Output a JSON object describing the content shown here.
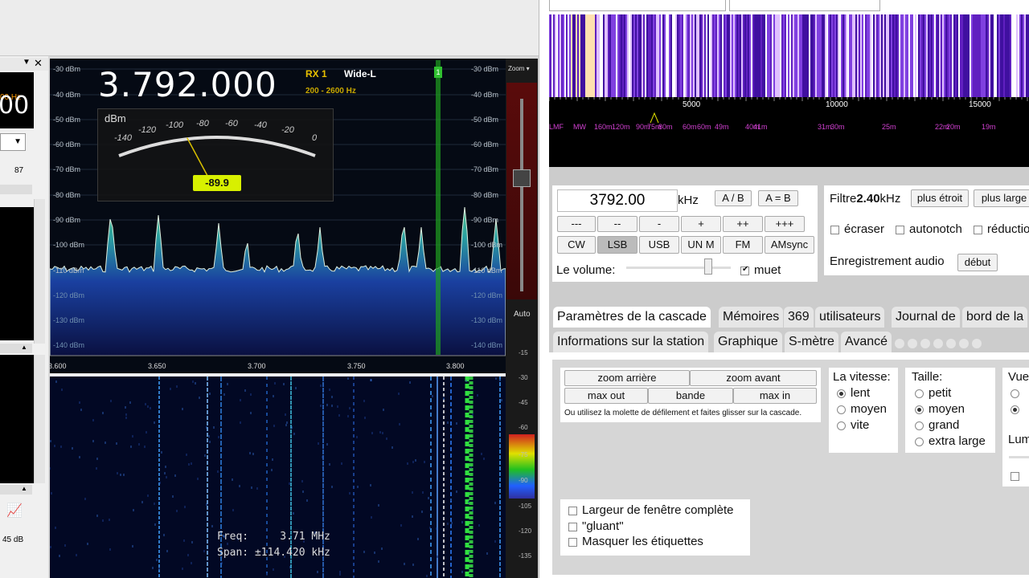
{
  "sdr": {
    "frequency": "3.792.000",
    "rx": "RX 1",
    "filter_mode": "Wide-L",
    "bandwidth": "200 - 2600 Hz",
    "smeter": {
      "unit": "dBm",
      "scale": [
        "-140",
        "-120",
        "-100",
        "-80",
        "-60",
        "-40",
        "-20",
        "0"
      ],
      "reading": "-89.9",
      "reading_dbm": -89.9
    },
    "db_left": [
      "-30 dBm",
      "-40 dBm",
      "-50 dBm",
      "-60 dBm",
      "-70 dBm",
      "-80 dBm",
      "-90 dBm",
      "-100 dBm",
      "-110 dBm",
      "-120 dBm",
      "-130 dBm",
      "-140 dBm"
    ],
    "db_right": [
      "-30 dBm",
      "-40 dBm",
      "-50 dBm",
      "-60 dBm",
      "-70 dBm",
      "-80 dBm",
      "-90 dBm",
      "-100 dBm",
      "-110 dBm",
      "-120 dBm",
      "-130 dBm",
      "-140 dBm"
    ],
    "freq_axis": [
      "3.600",
      "3.650",
      "3.700",
      "3.750",
      "3.800"
    ],
    "vfo_marker": "1",
    "zoom_label": "Zoom ▾",
    "auto_label": "Auto",
    "wf_scale": [
      "-15",
      "-30",
      "-45",
      "-60",
      "-75",
      "-90",
      "-105",
      "-120",
      "-135"
    ],
    "info_freq": "Freq:     3.71 MHz",
    "info_span": "Span: ±114.420 kHz",
    "side": {
      "freq_fragment": "00 Hz",
      "big_fragment": "00",
      "value_87": "87",
      "gain": "45 dB"
    }
  },
  "web": {
    "scale_values": [
      "5000",
      "10000",
      "15000"
    ],
    "bands": [
      "LMF",
      "MW",
      "160m",
      "120m",
      "90m",
      "75m",
      "80m",
      "60m",
      "60m",
      "49m",
      "40m",
      "41m",
      "31m",
      "30m",
      "25m",
      "22m",
      "20m",
      "19m"
    ],
    "frequency_input": "3792.00",
    "unit": "kHz",
    "ab_buttons": [
      "A / B",
      "A = B"
    ],
    "step_buttons": [
      "---",
      "--",
      "-",
      "+",
      "++",
      "+++"
    ],
    "modes": [
      "CW",
      "LSB",
      "USB",
      "UN M",
      "FM",
      "AMsync"
    ],
    "selected_mode": "LSB",
    "volume_label": "Le volume:",
    "volume_level": 0.81,
    "mute_label": "muet",
    "filter_label": "Filtre",
    "filter_value": "2.40",
    "filter_unit": "kHz",
    "narrower": "plus étroit",
    "wider": "plus large",
    "checkboxes_top": [
      "écraser",
      "autonotch",
      "réductio"
    ],
    "recording_label": "Enregistrement audio",
    "recording_button": "début",
    "tabs_row1": [
      "Paramètres de la cascade",
      "Mémoires",
      "369",
      "utilisateurs",
      "Journal de",
      "bord de la"
    ],
    "tabs_row2": [
      "Informations sur la station",
      "Graphique",
      "S-mètre",
      "Avancé"
    ],
    "zoom_buttons": [
      "zoom arrière",
      "zoom avant",
      "max out",
      "bande",
      "max in"
    ],
    "zoom_hint": "Ou utilisez la molette de défilement et faites glisser sur la cascade.",
    "speed_title": "La vitesse:",
    "speed_options": [
      "lent",
      "moyen",
      "vite"
    ],
    "size_title": "Taille:",
    "size_options": [
      "petit",
      "moyen",
      "grand",
      "extra large"
    ],
    "view_title": "Vue",
    "lum_title": "Lum",
    "bottom_checks": [
      "Largeur de fenêtre complète",
      "\"gluant\"",
      "Masquer les étiquettes"
    ]
  }
}
